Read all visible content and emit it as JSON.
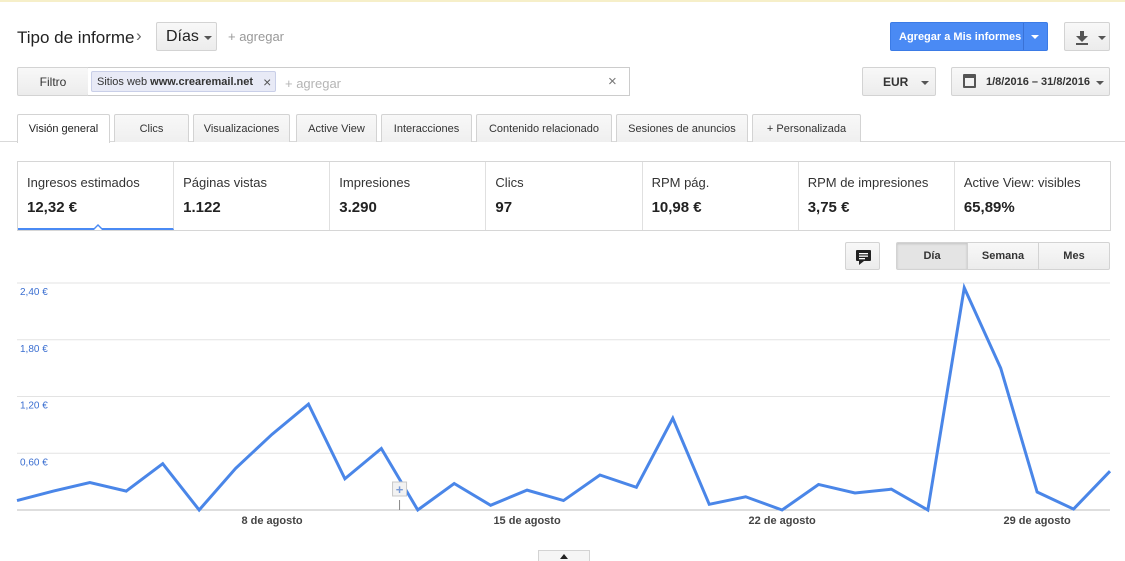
{
  "header": {
    "title": "Tipo de informe",
    "breadcrumb_separator": "›",
    "granularity_selector": "Días",
    "add_label": "+ agregar",
    "add_to_reports_button": "Agregar a Mis informes",
    "download_icon": "download-icon"
  },
  "filter": {
    "button_label": "Filtro",
    "chip": {
      "prefix": "Sitios web",
      "value": "www.crearemail.net",
      "remove_icon": "×"
    },
    "add_placeholder": "+ agregar",
    "clear_icon": "×"
  },
  "currency": {
    "value": "EUR"
  },
  "date_range": {
    "value": "1/8/2016 – 31/8/2016",
    "icon": "calendar-icon"
  },
  "tabs": [
    {
      "label": "Visión general",
      "active": true
    },
    {
      "label": "Clics",
      "active": false
    },
    {
      "label": "Visualizaciones",
      "active": false
    },
    {
      "label": "Active View",
      "active": false
    },
    {
      "label": "Interacciones",
      "active": false
    },
    {
      "label": "Contenido relacionado",
      "active": false
    },
    {
      "label": "Sesiones de anuncios",
      "active": false
    },
    {
      "label": "+ Personalizada",
      "active": false
    }
  ],
  "metrics": [
    {
      "label": "Ingresos estimados",
      "value": "12,32 €",
      "active": true
    },
    {
      "label": "Páginas vistas",
      "value": "1.122"
    },
    {
      "label": "Impresiones",
      "value": "3.290"
    },
    {
      "label": "Clics",
      "value": "97"
    },
    {
      "label": "RPM pág.",
      "value": "10,98 €"
    },
    {
      "label": "RPM de impresiones",
      "value": "3,75 €"
    },
    {
      "label": "Active View: visibles",
      "value": "65,89%"
    }
  ],
  "chart_controls": {
    "annotation_icon": "comment-icon",
    "periods": [
      {
        "label": "Día",
        "selected": true
      },
      {
        "label": "Semana",
        "selected": false
      },
      {
        "label": "Mes",
        "selected": false
      }
    ]
  },
  "colors": {
    "accent": "#4a8af4",
    "line": "#4a86e8",
    "axis_label": "#3b6fd1"
  },
  "chart_data": {
    "type": "line",
    "title": "",
    "xlabel": "",
    "ylabel": "",
    "ylim": [
      0,
      2.4
    ],
    "y_ticks": [
      "0,60 €",
      "1,20 €",
      "1,80 €",
      "2,40 €"
    ],
    "y_tick_values": [
      0.6,
      1.2,
      1.8,
      2.4
    ],
    "x_tick_labels": [
      "8 de agosto",
      "15 de agosto",
      "22 de agosto",
      "29 de agosto"
    ],
    "x_tick_days": [
      8,
      15,
      22,
      29
    ],
    "x": [
      1,
      2,
      3,
      4,
      5,
      6,
      7,
      8,
      9,
      10,
      11,
      12,
      13,
      14,
      15,
      16,
      17,
      18,
      19,
      20,
      21,
      22,
      23,
      24,
      25,
      26,
      27,
      28,
      29,
      30,
      31
    ],
    "series": [
      {
        "values": [
          0.1,
          0.2,
          0.29,
          0.2,
          0.49,
          0.0,
          0.44,
          0.8,
          1.12,
          0.33,
          0.65,
          0.0,
          0.28,
          0.05,
          0.21,
          0.1,
          0.37,
          0.24,
          0.97,
          0.06,
          0.14,
          0.0,
          0.27,
          0.18,
          0.22,
          0.0,
          2.35,
          1.5,
          0.19,
          0.01,
          0.41
        ]
      }
    ],
    "grid": true,
    "legend": "none"
  }
}
